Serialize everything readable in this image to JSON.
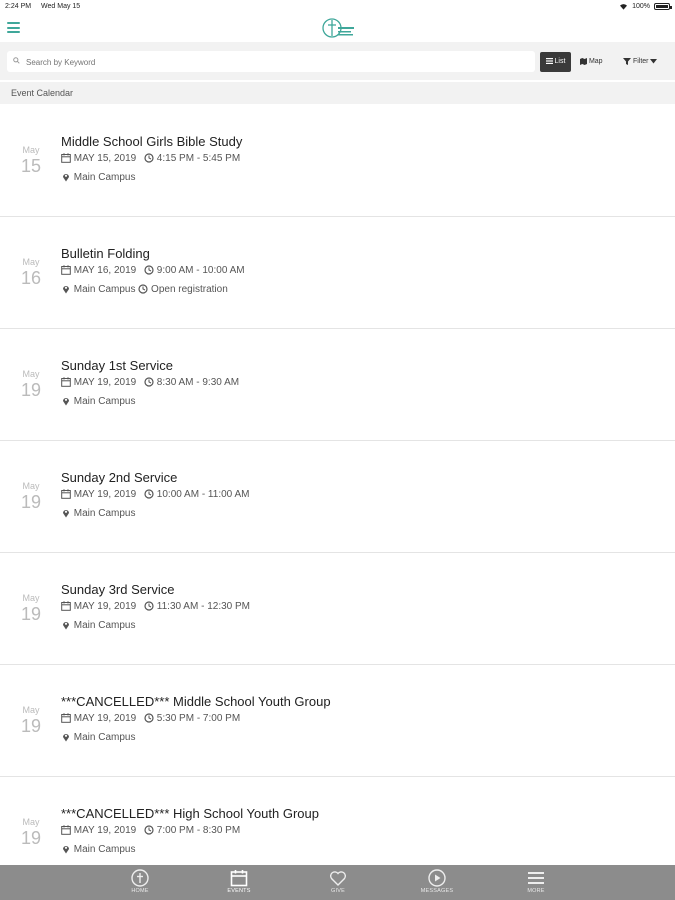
{
  "status_bar": {
    "time": "2:24 PM",
    "date": "Wed May 15",
    "battery": "100%"
  },
  "search": {
    "placeholder": "Search by Keyword"
  },
  "view_toggle": {
    "list_label": "List",
    "map_label": "Map",
    "filter_label": "Filter"
  },
  "section": {
    "title": "Event Calendar"
  },
  "events": [
    {
      "month": "May",
      "day": "15",
      "title": "Middle School Girls Bible Study",
      "date": "MAY 15, 2019",
      "time": "4:15 PM - 5:45 PM",
      "location": "Main Campus",
      "extra": ""
    },
    {
      "month": "May",
      "day": "16",
      "title": "Bulletin Folding",
      "date": "MAY 16, 2019",
      "time": "9:00 AM - 10:00 AM",
      "location": "Main Campus",
      "extra": "Open registration"
    },
    {
      "month": "May",
      "day": "19",
      "title": "Sunday 1st Service",
      "date": "MAY 19, 2019",
      "time": "8:30 AM - 9:30 AM",
      "location": "Main Campus",
      "extra": ""
    },
    {
      "month": "May",
      "day": "19",
      "title": "Sunday 2nd Service",
      "date": "MAY 19, 2019",
      "time": "10:00 AM - 11:00 AM",
      "location": "Main Campus",
      "extra": ""
    },
    {
      "month": "May",
      "day": "19",
      "title": "Sunday 3rd Service",
      "date": "MAY 19, 2019",
      "time": "11:30 AM - 12:30 PM",
      "location": "Main Campus",
      "extra": ""
    },
    {
      "month": "May",
      "day": "19",
      "title": "***CANCELLED*** Middle School Youth Group",
      "date": "MAY 19, 2019",
      "time": "5:30 PM - 7:00 PM",
      "location": "Main Campus",
      "extra": ""
    },
    {
      "month": "May",
      "day": "19",
      "title": "***CANCELLED*** High School Youth Group",
      "date": "MAY 19, 2019",
      "time": "7:00 PM - 8:30 PM",
      "location": "Main Campus",
      "extra": ""
    }
  ],
  "tabs": [
    {
      "label": "HOME",
      "icon": "home-icon"
    },
    {
      "label": "EVENTS",
      "icon": "calendar-icon"
    },
    {
      "label": "GIVE",
      "icon": "heart-icon"
    },
    {
      "label": "MESSAGES",
      "icon": "play-icon"
    },
    {
      "label": "MORE",
      "icon": "menu-icon"
    }
  ],
  "colors": {
    "accent": "#3fa79a",
    "tab_bar": "#8c8c8c",
    "list_button": "#3a3a3a"
  }
}
